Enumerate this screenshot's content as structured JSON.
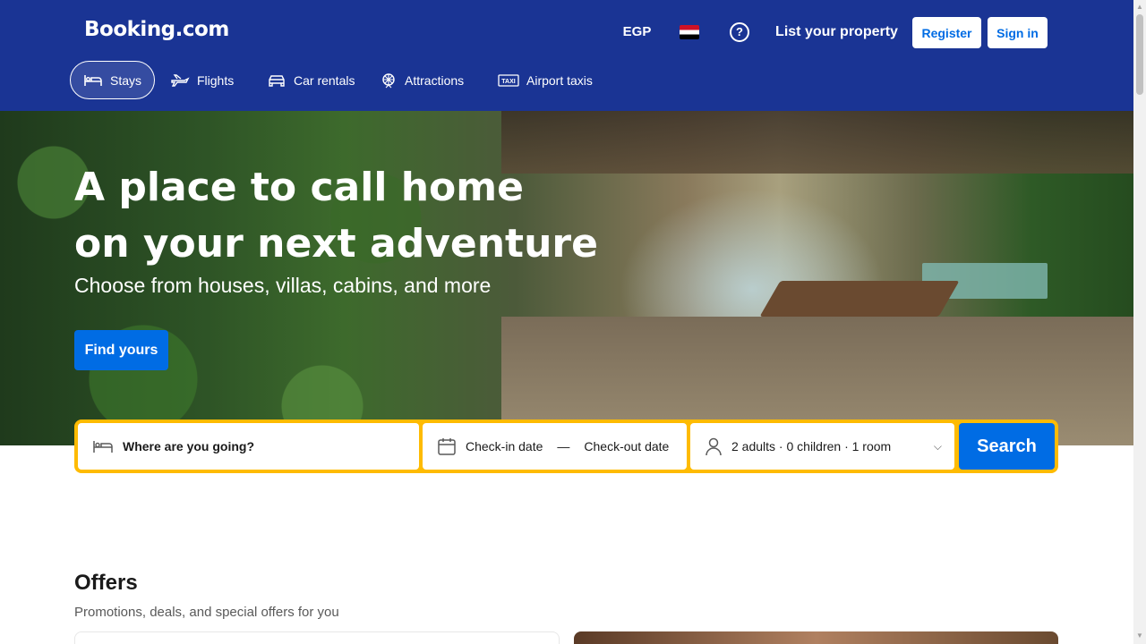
{
  "header": {
    "logo": "Booking.com",
    "currency": "EGP",
    "help_glyph": "?",
    "list_property": "List your property",
    "register": "Register",
    "sign_in": "Sign in"
  },
  "nav": {
    "items": [
      {
        "label": "Stays",
        "icon": "bed-icon",
        "active": true
      },
      {
        "label": "Flights",
        "icon": "plane-icon",
        "active": false
      },
      {
        "label": "Car rentals",
        "icon": "car-icon",
        "active": false
      },
      {
        "label": "Attractions",
        "icon": "attractions-icon",
        "active": false
      },
      {
        "label": "Airport taxis",
        "icon": "taxi-icon",
        "active": false
      }
    ]
  },
  "hero": {
    "title_line1": "A place to call home",
    "title_line2": "on your next adventure",
    "subtitle": "Choose from houses, villas, cabins, and more",
    "cta": "Find yours"
  },
  "search": {
    "destination_placeholder": "Where are you going?",
    "check_in": "Check-in date",
    "date_separator": "—",
    "check_out": "Check-out date",
    "guests": "2 adults · 0 children · 1 room",
    "button": "Search"
  },
  "offers": {
    "title": "Offers",
    "subtitle": "Promotions, deals, and special offers for you"
  },
  "colors": {
    "brand_blue": "#1a3494",
    "action_blue": "#006ce4",
    "search_yellow": "#febb02"
  }
}
